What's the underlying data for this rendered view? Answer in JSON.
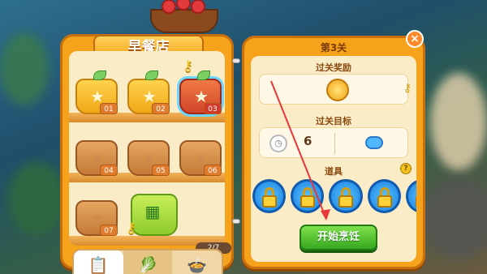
{
  "shop": {
    "title": "早餐店",
    "progress": "2/7",
    "items": [
      {
        "num": "01"
      },
      {
        "num": "02"
      },
      {
        "num": "03"
      },
      {
        "num": "04"
      },
      {
        "num": "05"
      },
      {
        "num": "06"
      },
      {
        "num": "07"
      }
    ],
    "tabs": [
      "clipboard-icon",
      "cabbage-icon",
      "pot-icon"
    ]
  },
  "level": {
    "title": "第3关",
    "reward_title": "过关奖励",
    "goal_title": "过关目标",
    "goal_value": "6",
    "props_title": "道具",
    "help": "?",
    "start_label": "开始烹饪",
    "close": "×"
  },
  "colors": {
    "panel": "#f6a21a",
    "start": "#36a820",
    "lock": "#1c7fe0"
  }
}
